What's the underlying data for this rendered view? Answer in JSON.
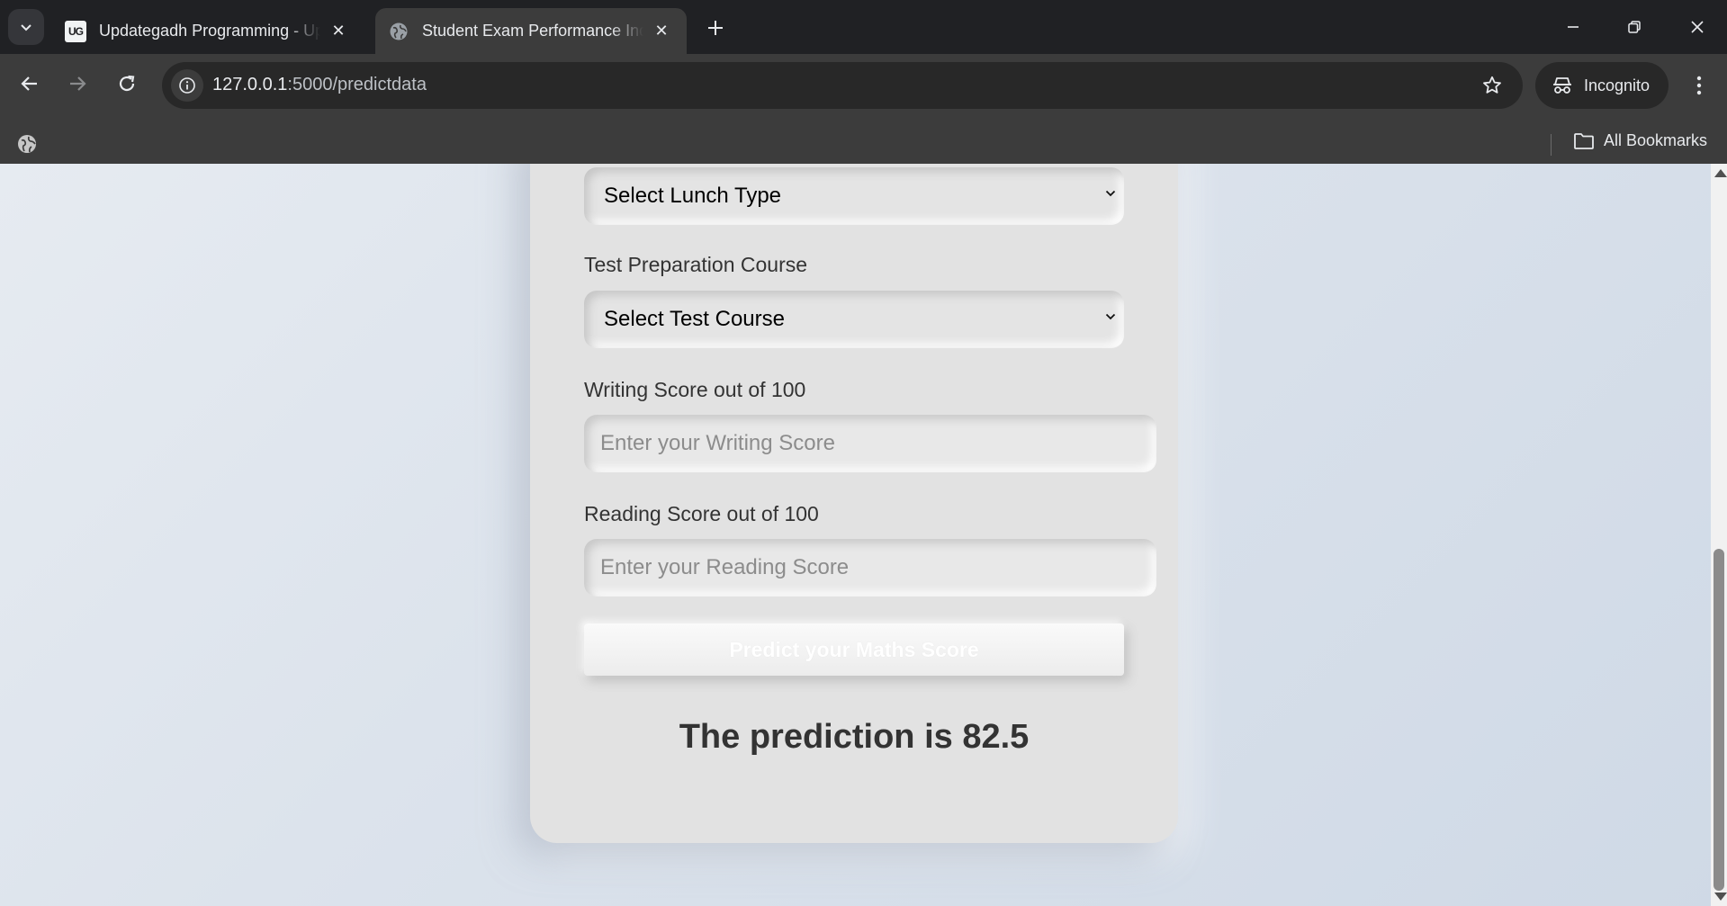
{
  "browser": {
    "tabs": [
      {
        "title": "Updategadh Programming - Up",
        "favicon": "UG",
        "active": false
      },
      {
        "title": "Student Exam Performance Indi",
        "favicon": "globe-icon",
        "active": true
      }
    ],
    "url_host": "127.0.0.1",
    "url_path": ":5000/predictdata",
    "profile_label": "Incognito",
    "bookmarks_label": "All Bookmarks"
  },
  "form": {
    "lunch_select_value": "Select Lunch Type",
    "test_prep_label": "Test Preparation Course",
    "test_prep_select_value": "Select Test Course",
    "writing_label": "Writing Score out of 100",
    "writing_placeholder": "Enter your Writing Score",
    "reading_label": "Reading Score out of 100",
    "reading_placeholder": "Enter your Reading Score",
    "submit_label": "Predict your Maths Score"
  },
  "result": {
    "text": "The prediction is 82.5"
  },
  "colors": {
    "page_bg": "#dce3ec",
    "card_bg": "#e2e2e2",
    "text_dark": "#333333"
  }
}
